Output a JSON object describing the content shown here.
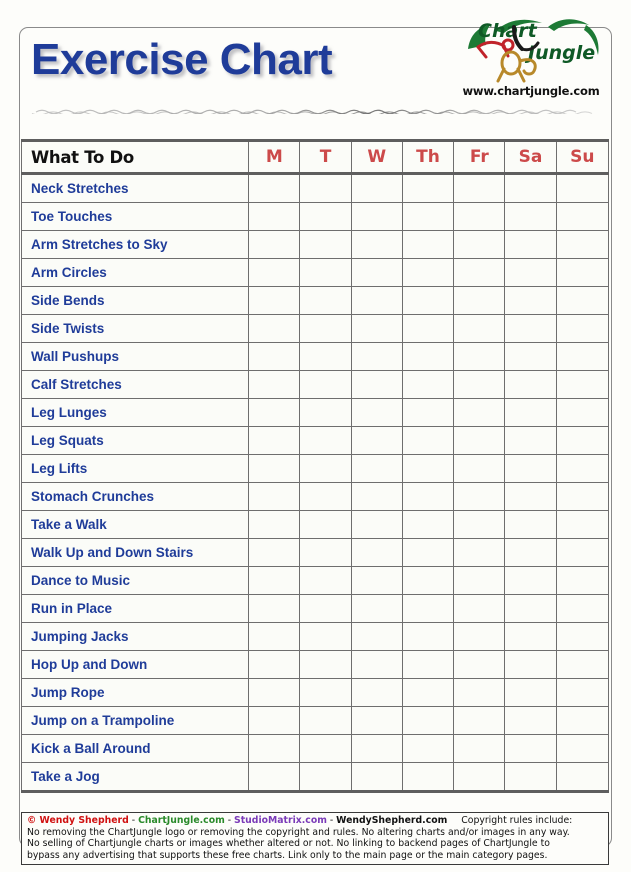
{
  "header": {
    "title": "Exercise Chart",
    "logo_name": "chartjungle-logo",
    "logo_text_chart": "Chart",
    "logo_text_jungle": "Jungle",
    "logo_url": "www.chartjungle.com",
    "divider_name": "squiggle-divider"
  },
  "table": {
    "task_header": "What To Do",
    "day_headers": [
      "M",
      "T",
      "W",
      "Th",
      "Fr",
      "Sa",
      "Su"
    ],
    "rows": [
      "Neck Stretches",
      "Toe Touches",
      "Arm Stretches to Sky",
      "Arm Circles",
      "Side Bends",
      "Side Twists",
      "Wall Pushups",
      "Calf Stretches",
      "Leg Lunges",
      "Leg Squats",
      "Leg Lifts",
      "Stomach Crunches",
      "Take a Walk",
      "Walk Up and Down Stairs",
      "Dance to Music",
      "Run in Place",
      "Jumping Jacks",
      "Hop Up and Down",
      "Jump Rope",
      "Jump on a Trampoline",
      "Kick a Ball Around",
      "Take a Jog"
    ]
  },
  "footer": {
    "copyright_symbol": "©",
    "author": "Wendy Shepherd",
    "sep1": " - ",
    "link_chartjungle": "ChartJungle.com",
    "sep2": " - ",
    "link_studiomatrix": "StudioMatrix.com",
    "sep3": " - ",
    "link_wendyshepherd": "WendyShepherd.com",
    "rules_intro": "Copyright rules include:",
    "rules_line1": "No removing the ChartJungle logo or removing the copyright and rules. No altering charts and/or images in any way.",
    "rules_line2": "No selling of Chartjungle charts or images whether altered or not. No linking to backend pages of ChartJungle to",
    "rules_line3": "bypass any advertising that supports these free charts. Link only to the main page or the main category pages."
  },
  "colors": {
    "title_blue": "#1f3c99",
    "task_blue": "#1f3c99",
    "day_red": "#cc4a4a",
    "grid_gray": "#6e6e6e",
    "heavy_rule": "#5e5e5e",
    "cell_bg": "#fbfcf8",
    "footer_red": "#d01010",
    "footer_green": "#2a8a2a",
    "footer_purple": "#7a3ab8"
  }
}
